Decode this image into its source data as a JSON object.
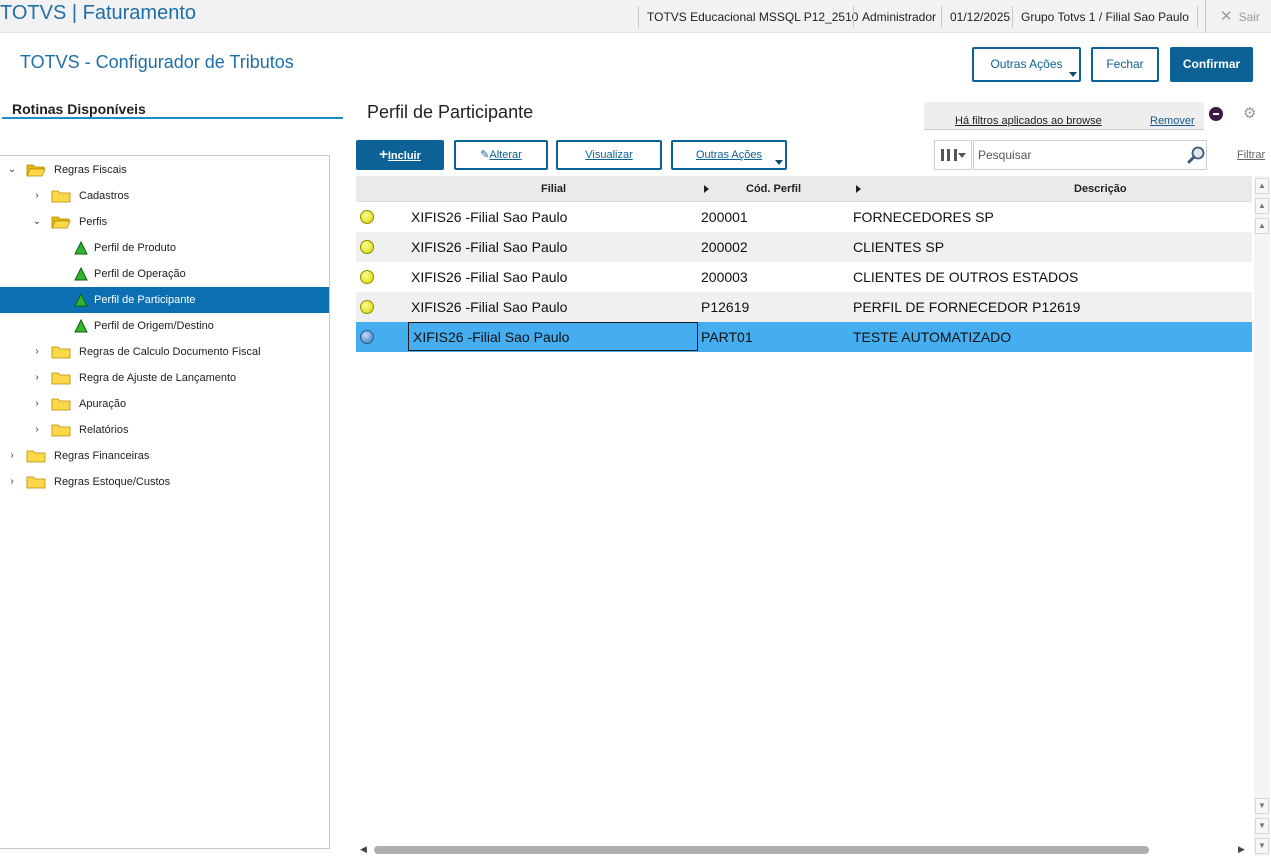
{
  "topbar": {
    "app_title": "TOTVS | Faturamento",
    "environment": "TOTVS Educacional MSSQL P12_2510",
    "user": "Administrador",
    "date": "01/12/2025",
    "company": "Grupo Totvs 1 / Filial Sao Paulo",
    "exit_label": "Sair"
  },
  "header": {
    "title": "TOTVS - Configurador de Tributos",
    "other_actions_label": "Outras Ações",
    "close_label": "Fechar",
    "confirm_label": "Confirmar"
  },
  "sidebar": {
    "title": "Rotinas Disponíveis",
    "tree": [
      {
        "label": "Regras Fiscais",
        "type": "folder",
        "expanded": true
      },
      {
        "label": "Cadastros",
        "type": "folder",
        "expanded": false
      },
      {
        "label": "Perfis",
        "type": "folder",
        "expanded": true
      },
      {
        "label": "Perfil de Produto",
        "type": "item"
      },
      {
        "label": "Perfil de Operação",
        "type": "item"
      },
      {
        "label": "Perfil de Participante",
        "type": "item",
        "selected": true
      },
      {
        "label": "Perfil de Origem/Destino",
        "type": "item"
      },
      {
        "label": "Regras de Calculo Documento Fiscal",
        "type": "folder",
        "expanded": false
      },
      {
        "label": "Regra de Ajuste de Lançamento",
        "type": "folder",
        "expanded": false
      },
      {
        "label": "Apuração",
        "type": "folder",
        "expanded": false
      },
      {
        "label": "Relatórios",
        "type": "folder",
        "expanded": false
      },
      {
        "label": "Regras Financeiras",
        "type": "folder",
        "expanded": false
      },
      {
        "label": "Regras Estoque/Custos",
        "type": "folder",
        "expanded": false
      }
    ]
  },
  "browse": {
    "title": "Perfil de Participante",
    "filters_applied_label": "Há filtros aplicados ao browse",
    "remove_label": "Remover",
    "toolbar": {
      "include_label": "Incluir",
      "edit_label": "Alterar",
      "view_label": "Visualizar",
      "other_actions_label": "Outras Ações"
    },
    "search_placeholder": "Pesquisar",
    "filter_label": "Filtrar",
    "columns": [
      "Filial",
      "Cód. Perfil",
      "Descrição"
    ],
    "rows": [
      {
        "filial": "XIFIS26 -Filial Sao Paulo",
        "codigo": "200001",
        "descricao": "FORNECEDORES SP",
        "status": "yellow"
      },
      {
        "filial": "XIFIS26 -Filial Sao Paulo",
        "codigo": "200002",
        "descricao": "CLIENTES SP",
        "status": "yellow"
      },
      {
        "filial": "XIFIS26 -Filial Sao Paulo",
        "codigo": "200003",
        "descricao": "CLIENTES DE OUTROS ESTADOS",
        "status": "yellow"
      },
      {
        "filial": "XIFIS26 -Filial Sao Paulo",
        "codigo": "P12619",
        "descricao": "PERFIL DE FORNECEDOR P12619",
        "status": "yellow"
      },
      {
        "filial": "XIFIS26 -Filial Sao Paulo",
        "codigo": "PART01",
        "descricao": "TESTE AUTOMATIZADO",
        "status": "blue",
        "selected": true
      }
    ]
  },
  "colors": {
    "brand": "#1e6fa8",
    "primary_button": "#0c6296",
    "selected_tree": "#0c6fb2",
    "selected_row": "#44aef0"
  }
}
